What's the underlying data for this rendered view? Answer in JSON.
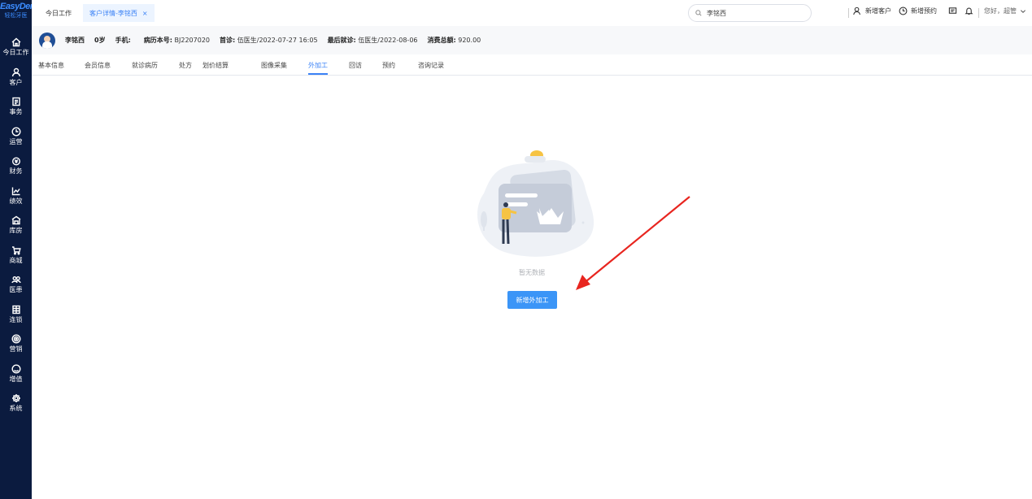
{
  "brand": {
    "logo_main": "EasyDent",
    "logo_sub": "轻松牙医"
  },
  "sidebar": {
    "items": [
      {
        "label": "今日工作",
        "icon": "home-icon"
      },
      {
        "label": "客户",
        "icon": "user-icon"
      },
      {
        "label": "事务",
        "icon": "task-icon"
      },
      {
        "label": "运营",
        "icon": "clock-icon"
      },
      {
        "label": "财务",
        "icon": "money-icon"
      },
      {
        "label": "绩效",
        "icon": "chart-icon"
      },
      {
        "label": "库房",
        "icon": "warehouse-icon"
      },
      {
        "label": "商城",
        "icon": "cart-icon"
      },
      {
        "label": "医患",
        "icon": "people-icon"
      },
      {
        "label": "连锁",
        "icon": "chain-icon"
      },
      {
        "label": "营销",
        "icon": "marketing-icon"
      },
      {
        "label": "增值",
        "icon": "value-added-icon"
      },
      {
        "label": "系统",
        "icon": "gear-icon"
      }
    ]
  },
  "topbar": {
    "tabs": [
      {
        "label": "今日工作"
      },
      {
        "label": "客户详情-李铭西",
        "close": "×"
      }
    ],
    "search": {
      "value": "李铭西"
    },
    "actions": {
      "new_customer": "新增客户",
      "new_appointment": "新增预约",
      "greeting": "您好，超管"
    }
  },
  "patient": {
    "name": "李铭西",
    "age": "0岁",
    "phone_label": "手机:",
    "record_label": "病历本号:",
    "record_value": "BJ2207020",
    "first_label": "首诊:",
    "first_value": "伍医生/2022-07-27 16:05",
    "last_label": "最后就诊:",
    "last_value": "伍医生/2022-08-06",
    "total_label": "消费总额:",
    "total_value": "920.00"
  },
  "subtabs": {
    "items": [
      {
        "label": "基本信息"
      },
      {
        "label": "会员信息"
      },
      {
        "label": "就诊病历"
      },
      {
        "label": "处方"
      },
      {
        "label": "划价结算"
      },
      {
        "label": "图像采集"
      },
      {
        "label": "外加工"
      },
      {
        "label": "回访"
      },
      {
        "label": "预约"
      },
      {
        "label": "咨询记录"
      }
    ],
    "active": "外加工"
  },
  "empty": {
    "text": "暂无数据",
    "button": "新增外加工"
  },
  "colors": {
    "sidebar_bg": "#0b1b3f",
    "accent": "#3b82f6",
    "button": "#3b95f7",
    "arrow": "#e8251f"
  }
}
